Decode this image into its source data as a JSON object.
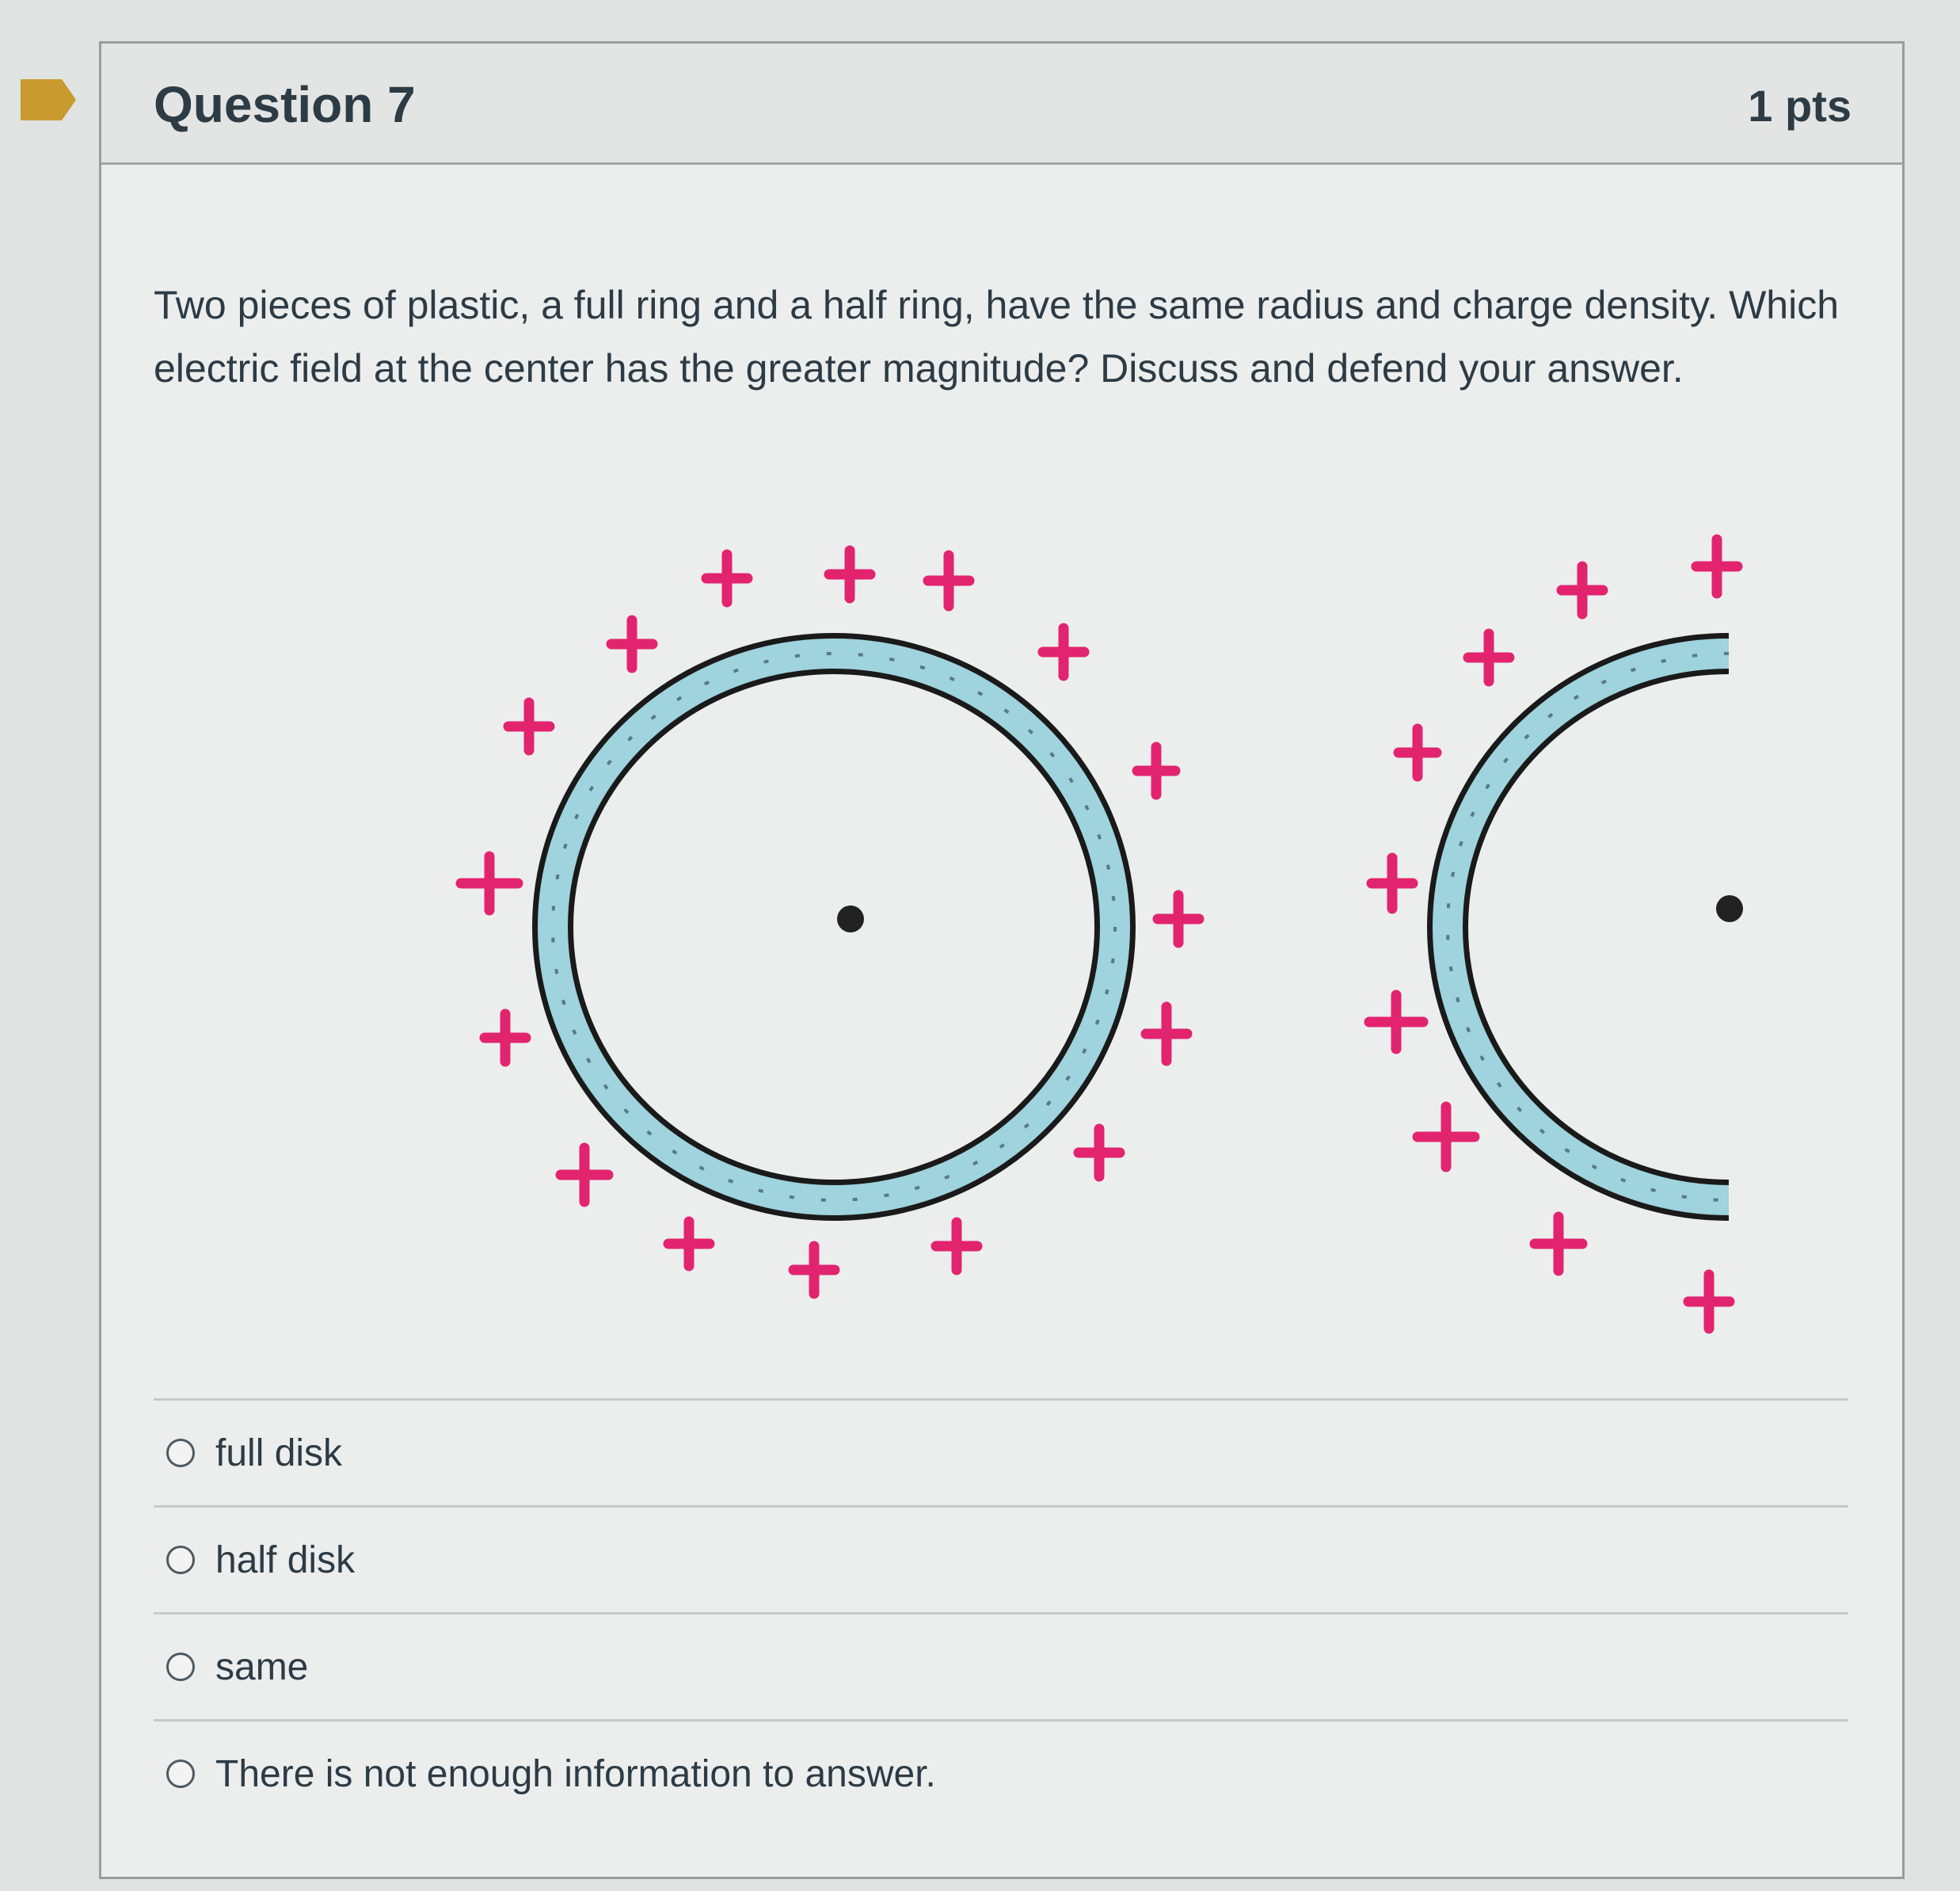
{
  "question": {
    "title": "Question 7",
    "points": "1 pts",
    "text": "Two pieces of plastic, a full ring and a half ring, have the same radius and charge density. Which electric field at the center has the greater magnitude? Discuss and defend your answer."
  },
  "answers": [
    {
      "label": "full disk",
      "selected": false
    },
    {
      "label": "half disk",
      "selected": false
    },
    {
      "label": "same",
      "selected": false
    },
    {
      "label": "There is not enough information to answer.",
      "selected": false
    }
  ],
  "colors": {
    "ring_fill": "#9fd3dd",
    "charge_sign": "#e2246f",
    "bookmark": "#c99a2e",
    "text": "#2d3b45"
  },
  "figure": {
    "charge_symbol": "+",
    "center_marker": "dot"
  }
}
